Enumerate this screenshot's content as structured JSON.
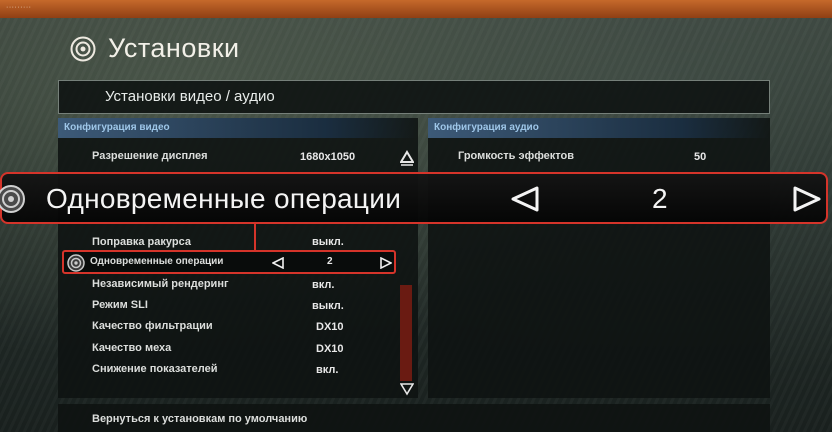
{
  "window": {
    "title": "Установки"
  },
  "subtitle": "Установки видео / аудио",
  "video": {
    "header": "Конфигурация видео",
    "rows": [
      {
        "label": "Разрешение дисплея",
        "value": "1680x1050"
      },
      {
        "label": "Поправка ракурса",
        "value": "выкл."
      },
      {
        "label": "Одновременные операции",
        "value": "2"
      },
      {
        "label": "Независимый рендеринг",
        "value": "вкл."
      },
      {
        "label": "Режим SLI",
        "value": "выкл."
      },
      {
        "label": "Качество фильтрации",
        "value": "DX10"
      },
      {
        "label": "Качество меха",
        "value": "DX10"
      },
      {
        "label": "Снижение показателей",
        "value": "вкл."
      }
    ]
  },
  "audio": {
    "header": "Конфигурация аудио",
    "rows": [
      {
        "label": "Громкость эффектов",
        "value": "50"
      }
    ]
  },
  "zoom": {
    "label": "Одновременные операции",
    "value": "2"
  },
  "footer": {
    "reset_label": "Вернуться к установкам по умолчанию"
  },
  "colors": {
    "accent": "#d5342a",
    "topbar": "#c5692b",
    "section_header": "#3d5a78",
    "section_header_text": "#9ec6e8",
    "scroll_track": "#6a1b12"
  },
  "icons": {
    "header": "target-icon",
    "selected": "target-icon",
    "left": "left-arrow-icon",
    "right": "right-arrow-icon",
    "scroll_up": "up-arrow-icon",
    "scroll_down": "down-arrow-icon"
  }
}
